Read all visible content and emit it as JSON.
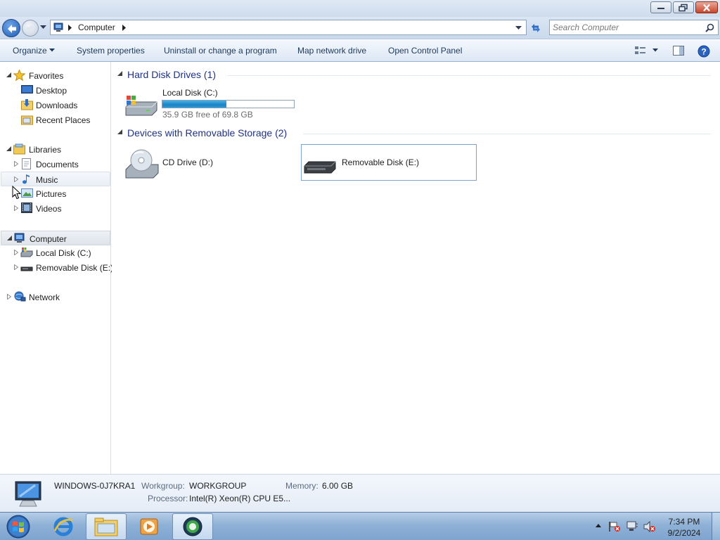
{
  "window": {
    "buttons": {
      "minimize": "minimize",
      "maximize": "restore",
      "close": "close"
    }
  },
  "navigation": {
    "address_segments": [
      "Computer"
    ],
    "search_placeholder": "Search Computer"
  },
  "command_bar": {
    "organize": "Organize",
    "system_properties": "System properties",
    "uninstall": "Uninstall or change a program",
    "map_drive": "Map network drive",
    "control_panel": "Open Control Panel"
  },
  "nav_pane": {
    "favorites": {
      "label": "Favorites",
      "items": [
        "Desktop",
        "Downloads",
        "Recent Places"
      ]
    },
    "libraries": {
      "label": "Libraries",
      "items": [
        "Documents",
        "Music",
        "Pictures",
        "Videos"
      ]
    },
    "computer": {
      "label": "Computer",
      "items": [
        "Local Disk (C:)",
        "Removable Disk (E:)"
      ]
    },
    "network": {
      "label": "Network"
    }
  },
  "content": {
    "hard_disks": {
      "header": "Hard Disk Drives (1)",
      "drives": [
        {
          "name": "Local Disk (C:)",
          "free_text": "35.9 GB free of 69.8 GB",
          "used_fraction": 0.486
        }
      ]
    },
    "removable": {
      "header": "Devices with Removable Storage (2)",
      "drives": [
        {
          "name": "CD Drive (D:)"
        },
        {
          "name": "Removable Disk (E:)"
        }
      ]
    }
  },
  "details": {
    "computer_name": "WINDOWS-0J7KRA1",
    "workgroup_label": "Workgroup:",
    "workgroup_value": "WORKGROUP",
    "memory_label": "Memory:",
    "memory_value": "6.00 GB",
    "processor_label": "Processor:",
    "processor_value": "Intel(R) Xeon(R) CPU E5..."
  },
  "taskbar": {
    "clock_time": "7:34 PM",
    "clock_date": "9/2/2024",
    "pinned": [
      "internet-explorer-icon",
      "windows-explorer-icon",
      "media-player-icon",
      "unknown-app-icon"
    ],
    "active": "windows-explorer-icon"
  }
}
